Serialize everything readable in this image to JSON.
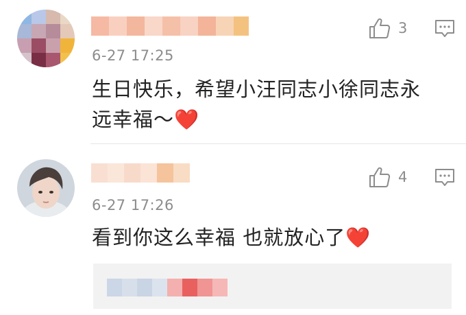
{
  "comments": [
    {
      "timestamp": "6-27 17:25",
      "text_line1": "生日快乐，希望小汪同志小徐同志永",
      "text_line2": "远幸福～",
      "emoji": "❤️",
      "likes": "3",
      "like_icon": "thumbs-up-icon",
      "reply_icon": "comment-icon"
    },
    {
      "timestamp": "6-27 17:26",
      "text": "看到你这么幸福 也就放心了",
      "emoji": "❤️",
      "likes": "4",
      "like_icon": "thumbs-up-icon",
      "reply_icon": "comment-icon"
    }
  ],
  "colors": {
    "text": "#222222",
    "meta": "#8c8c8c",
    "heart": "#e62020",
    "divider": "#e6e6e6",
    "sub_reply_bg": "#f2f2f2"
  }
}
